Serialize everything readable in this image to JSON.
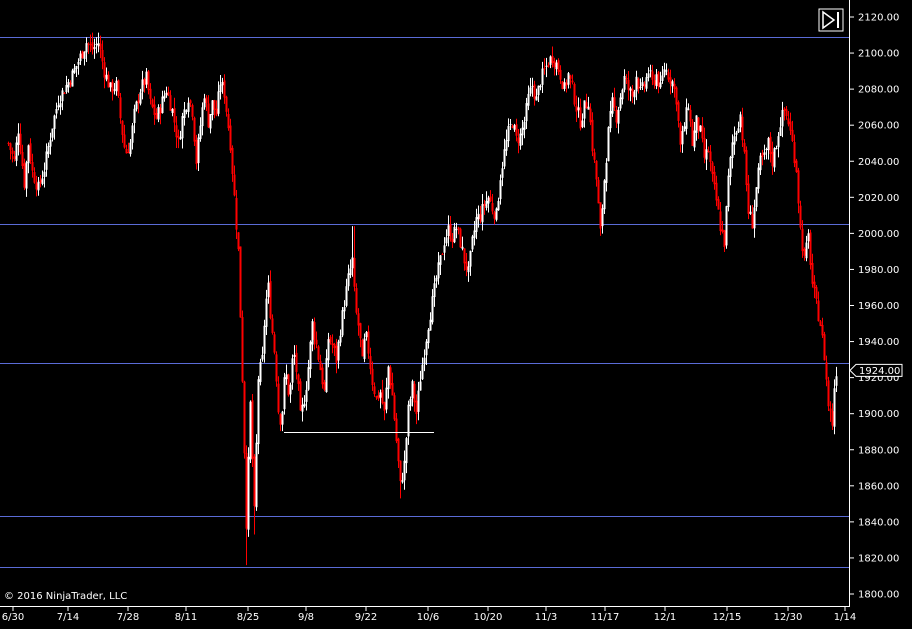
{
  "copyright": "© 2016 NinjaTrader, LLC",
  "chart_data": {
    "type": "candlestick",
    "ylim": [
      1800,
      2120
    ],
    "y_ticks": [
      1800,
      1820,
      1840,
      1860,
      1880,
      1900,
      1920,
      1940,
      1960,
      1980,
      2000,
      2020,
      2040,
      2060,
      2080,
      2100,
      2120
    ],
    "y_tick_labels": [
      "1800.00",
      "1820.00",
      "1840.00",
      "1860.00",
      "1880.00",
      "1900.00",
      "1920.00",
      "1940.00",
      "1960.00",
      "1980.00",
      "2000.00",
      "2020.00",
      "2040.00",
      "2060.00",
      "2080.00",
      "2100.00",
      "2120.00"
    ],
    "x_tick_labels": [
      "6/30",
      "7/14",
      "7/28",
      "8/11",
      "8/25",
      "9/8",
      "9/22",
      "10/6",
      "10/20",
      "11/3",
      "11/17",
      "12/1",
      "12/15",
      "12/30",
      "1/14"
    ],
    "horizontal_lines": [
      2109,
      2005,
      1928,
      1843,
      1815
    ],
    "support_line": {
      "value": 1890,
      "from": "9/1",
      "to": "10/8"
    },
    "current_price": 1924.0,
    "current_price_label": "1924.00",
    "up_color": "#ffffff",
    "down_color": "#ff0000",
    "line_color": "#5a6bd6",
    "anchors": [
      [
        0,
        2035
      ],
      [
        8,
        2050
      ],
      [
        14,
        2040
      ],
      [
        18,
        2058
      ],
      [
        24,
        2028
      ],
      [
        28,
        2050
      ],
      [
        32,
        2034
      ],
      [
        38,
        2025
      ],
      [
        44,
        2036
      ],
      [
        52,
        2060
      ],
      [
        58,
        2074
      ],
      [
        64,
        2080
      ],
      [
        72,
        2088
      ],
      [
        80,
        2098
      ],
      [
        86,
        2106
      ],
      [
        92,
        2102
      ],
      [
        98,
        2106
      ],
      [
        104,
        2090
      ],
      [
        110,
        2080
      ],
      [
        116,
        2082
      ],
      [
        120,
        2064
      ],
      [
        125,
        2044
      ],
      [
        130,
        2050
      ],
      [
        134,
        2066
      ],
      [
        140,
        2080
      ],
      [
        146,
        2086
      ],
      [
        150,
        2072
      ],
      [
        156,
        2064
      ],
      [
        160,
        2070
      ],
      [
        166,
        2080
      ],
      [
        172,
        2068
      ],
      [
        178,
        2050
      ],
      [
        182,
        2064
      ],
      [
        188,
        2076
      ],
      [
        192,
        2068
      ],
      [
        196,
        2040
      ],
      [
        200,
        2060
      ],
      [
        204,
        2078
      ],
      [
        208,
        2062
      ],
      [
        212,
        2072
      ],
      [
        216,
        2066
      ],
      [
        220,
        2084
      ],
      [
        224,
        2078
      ],
      [
        230,
        2050
      ],
      [
        234,
        2020
      ],
      [
        238,
        1990
      ],
      [
        242,
        1920
      ],
      [
        246,
        1840
      ],
      [
        250,
        1905
      ],
      [
        254,
        1845
      ],
      [
        258,
        1920
      ],
      [
        262,
        1930
      ],
      [
        265,
        1960
      ],
      [
        268,
        1970
      ],
      [
        271,
        1950
      ],
      [
        275,
        1930
      ],
      [
        278,
        1902
      ],
      [
        281,
        1895
      ],
      [
        285,
        1925
      ],
      [
        289,
        1908
      ],
      [
        293,
        1936
      ],
      [
        297,
        1920
      ],
      [
        300,
        1898
      ],
      [
        303,
        1905
      ],
      [
        307,
        1920
      ],
      [
        312,
        1950
      ],
      [
        316,
        1938
      ],
      [
        320,
        1925
      ],
      [
        324,
        1912
      ],
      [
        328,
        1942
      ],
      [
        332,
        1938
      ],
      [
        336,
        1930
      ],
      [
        340,
        1947
      ],
      [
        344,
        1962
      ],
      [
        348,
        1975
      ],
      [
        352,
        1985
      ],
      [
        355,
        1958
      ],
      [
        359,
        1946
      ],
      [
        362,
        1928
      ],
      [
        365,
        1945
      ],
      [
        368,
        1935
      ],
      [
        372,
        1918
      ],
      [
        376,
        1908
      ],
      [
        380,
        1912
      ],
      [
        384,
        1900
      ],
      [
        388,
        1926
      ],
      [
        392,
        1910
      ],
      [
        396,
        1885
      ],
      [
        400,
        1860
      ],
      [
        404,
        1872
      ],
      [
        408,
        1902
      ],
      [
        412,
        1915
      ],
      [
        416,
        1900
      ],
      [
        420,
        1920
      ],
      [
        424,
        1935
      ],
      [
        428,
        1950
      ],
      [
        432,
        1962
      ],
      [
        436,
        1975
      ],
      [
        440,
        1985
      ],
      [
        444,
        1996
      ],
      [
        448,
        2002
      ],
      [
        452,
        1998
      ],
      [
        456,
        2003
      ],
      [
        460,
        1995
      ],
      [
        464,
        1985
      ],
      [
        468,
        1978
      ],
      [
        472,
        1995
      ],
      [
        476,
        2008
      ],
      [
        480,
        2010
      ],
      [
        484,
        2016
      ],
      [
        488,
        2020
      ],
      [
        492,
        2014
      ],
      [
        496,
        2010
      ],
      [
        500,
        2032
      ],
      [
        504,
        2045
      ],
      [
        508,
        2056
      ],
      [
        512,
        2062
      ],
      [
        516,
        2052
      ],
      [
        520,
        2054
      ],
      [
        524,
        2062
      ],
      [
        528,
        2075
      ],
      [
        532,
        2082
      ],
      [
        536,
        2074
      ],
      [
        540,
        2085
      ],
      [
        544,
        2090
      ],
      [
        548,
        2095
      ],
      [
        552,
        2098
      ],
      [
        556,
        2094
      ],
      [
        560,
        2088
      ],
      [
        564,
        2080
      ],
      [
        568,
        2088
      ],
      [
        572,
        2080
      ],
      [
        576,
        2070
      ],
      [
        580,
        2062
      ],
      [
        584,
        2070
      ],
      [
        588,
        2074
      ],
      [
        592,
        2048
      ],
      [
        596,
        2030
      ],
      [
        600,
        2000
      ],
      [
        604,
        2030
      ],
      [
        608,
        2056
      ],
      [
        612,
        2072
      ],
      [
        616,
        2065
      ],
      [
        620,
        2076
      ],
      [
        624,
        2086
      ],
      [
        628,
        2080
      ],
      [
        632,
        2076
      ],
      [
        636,
        2088
      ],
      [
        640,
        2078
      ],
      [
        644,
        2082
      ],
      [
        648,
        2090
      ],
      [
        652,
        2083
      ],
      [
        656,
        2088
      ],
      [
        660,
        2080
      ],
      [
        664,
        2092
      ],
      [
        668,
        2088
      ],
      [
        672,
        2084
      ],
      [
        676,
        2075
      ],
      [
        680,
        2048
      ],
      [
        684,
        2060
      ],
      [
        688,
        2072
      ],
      [
        692,
        2050
      ],
      [
        696,
        2062
      ],
      [
        700,
        2056
      ],
      [
        704,
        2042
      ],
      [
        708,
        2046
      ],
      [
        712,
        2030
      ],
      [
        716,
        2018
      ],
      [
        720,
        2004
      ],
      [
        724,
        1995
      ],
      [
        728,
        2030
      ],
      [
        732,
        2050
      ],
      [
        736,
        2058
      ],
      [
        740,
        2066
      ],
      [
        744,
        2042
      ],
      [
        748,
        2012
      ],
      [
        752,
        2006
      ],
      [
        756,
        2025
      ],
      [
        760,
        2040
      ],
      [
        764,
        2042
      ],
      [
        768,
        2050
      ],
      [
        772,
        2040
      ],
      [
        776,
        2050
      ],
      [
        780,
        2062
      ],
      [
        784,
        2068
      ],
      [
        788,
        2062
      ],
      [
        792,
        2050
      ],
      [
        796,
        2036
      ],
      [
        800,
        2002
      ],
      [
        804,
        1985
      ],
      [
        808,
        1998
      ],
      [
        812,
        1972
      ],
      [
        816,
        1960
      ],
      [
        820,
        1950
      ],
      [
        824,
        1932
      ],
      [
        828,
        1905
      ],
      [
        832,
        1895
      ],
      [
        834,
        1915
      ],
      [
        836,
        1924
      ]
    ]
  }
}
